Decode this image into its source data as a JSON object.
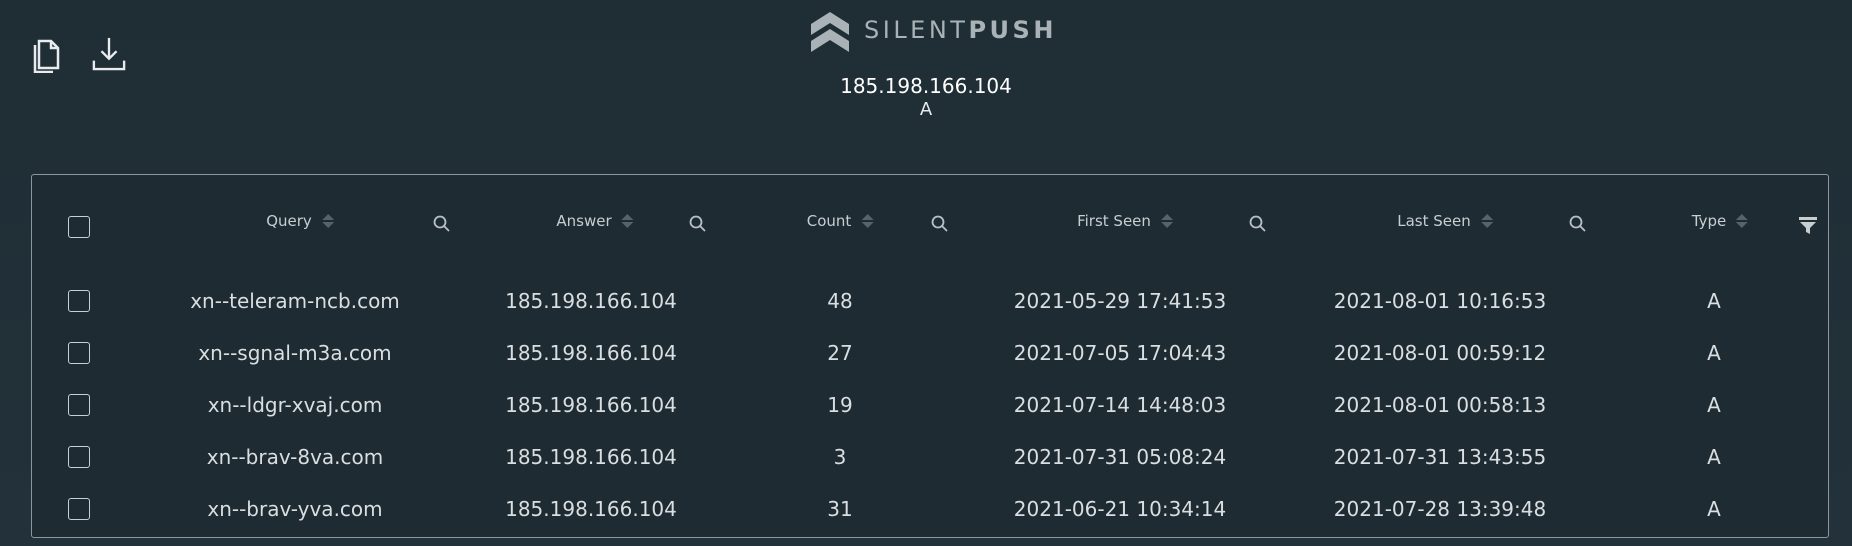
{
  "brand": {
    "light": "SILENT",
    "bold": "PUSH"
  },
  "subject": {
    "ip": "185.198.166.104",
    "type": "A"
  },
  "columns": [
    "Query",
    "Answer",
    "Count",
    "First Seen",
    "Last Seen",
    "Type"
  ],
  "rows": [
    {
      "query": "xn--teleram-ncb.com",
      "answer": "185.198.166.104",
      "count": "48",
      "first_seen": "2021-05-29 17:41:53",
      "last_seen": "2021-08-01 10:16:53",
      "type": "A"
    },
    {
      "query": "xn--sgnal-m3a.com",
      "answer": "185.198.166.104",
      "count": "27",
      "first_seen": "2021-07-05 17:04:43",
      "last_seen": "2021-08-01 00:59:12",
      "type": "A"
    },
    {
      "query": "xn--ldgr-xvaj.com",
      "answer": "185.198.166.104",
      "count": "19",
      "first_seen": "2021-07-14 14:48:03",
      "last_seen": "2021-08-01 00:58:13",
      "type": "A"
    },
    {
      "query": "xn--brav-8va.com",
      "answer": "185.198.166.104",
      "count": "3",
      "first_seen": "2021-07-31 05:08:24",
      "last_seen": "2021-07-31 13:43:55",
      "type": "A"
    },
    {
      "query": "xn--brav-yva.com",
      "answer": "185.198.166.104",
      "count": "31",
      "first_seen": "2021-06-21 10:34:14",
      "last_seen": "2021-07-28 13:39:48",
      "type": "A"
    }
  ],
  "icons": {
    "copy": "copy-icon",
    "download": "download-icon",
    "logo": "silentpush-logo-icon",
    "search": "search-icon",
    "sort": "sort-icon",
    "filter": "filter-icon"
  },
  "colors": {
    "background": "#1f2d35",
    "panel_border": "#8b979d",
    "text": "#d9dee1"
  }
}
